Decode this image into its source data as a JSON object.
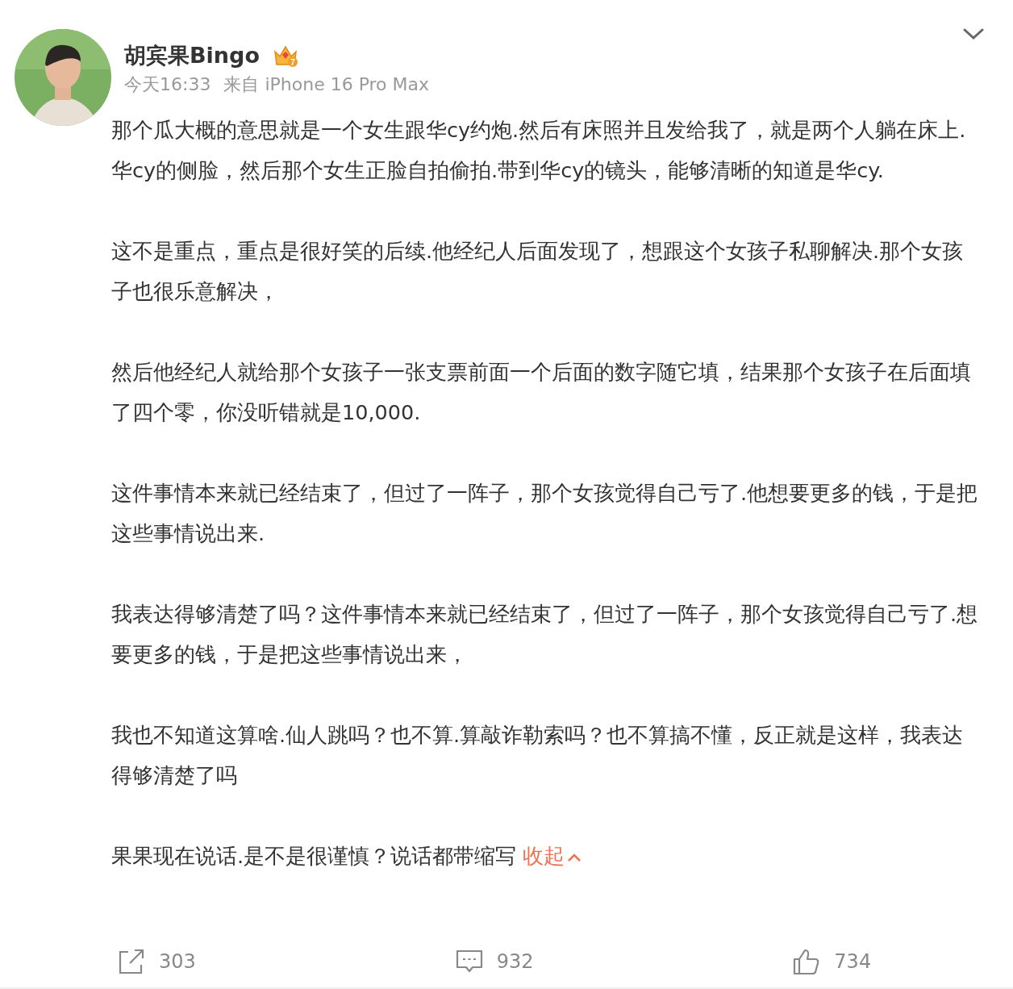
{
  "post": {
    "author": "胡宾果Bingo",
    "badge_level": "7",
    "time": "今天16:33",
    "source": "来自 iPhone 16 Pro Max",
    "paragraphs": [
      "那个瓜大概的意思就是一个女生跟华cy约炮.然后有床照并且发给我了，就是两个人躺在床上.华cy的侧脸，然后那个女生正脸自拍偷拍.带到华cy的镜头，能够清晰的知道是华cy.",
      "这不是重点，重点是很好笑的后续.他经纪人后面发现了，想跟这个女孩子私聊解决.那个女孩子也很乐意解决，",
      "然后他经纪人就给那个女孩子一张支票前面一个后面的数字随它填，结果那个女孩子在后面填了四个零，你没听错就是10,000.",
      "这件事情本来就已经结束了，但过了一阵子，那个女孩觉得自己亏了.他想要更多的钱，于是把这些事情说出来.",
      "我表达得够清楚了吗？这件事情本来就已经结束了，但过了一阵子，那个女孩觉得自己亏了.想要更多的钱，于是把这些事情说出来，",
      "我也不知道这算啥.仙人跳吗？也不算.算敲诈勒索吗？也不算搞不懂，反正就是这样，我表达得够清楚了吗",
      "果果现在说话.是不是很谨慎？说话都带缩写"
    ],
    "collapse_link": "收起"
  },
  "actions": [
    {
      "kind": "repost",
      "count": "303"
    },
    {
      "kind": "comment",
      "count": "932"
    },
    {
      "kind": "like",
      "count": "734"
    }
  ]
}
